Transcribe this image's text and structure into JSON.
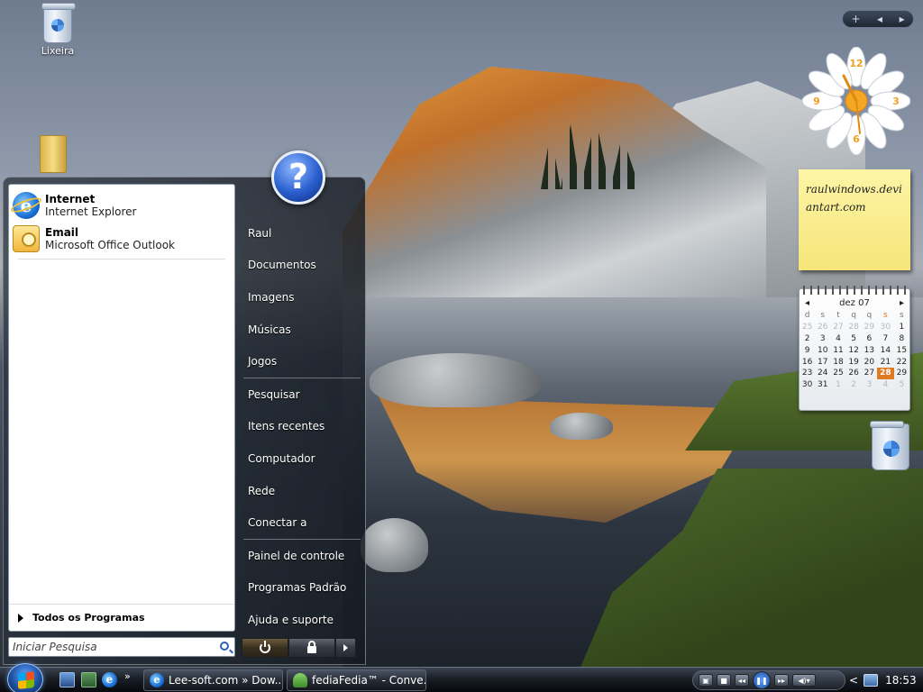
{
  "desktop": {
    "recycle_bin_label": "Lixeira"
  },
  "gadgets": {
    "clock": {
      "numerals": [
        "12",
        "3",
        "6",
        "9"
      ]
    },
    "note": {
      "text": "raulwindows.deviantart.com"
    },
    "calendar": {
      "month_label": "dez 07",
      "day_headers": [
        "d",
        "s",
        "t",
        "q",
        "q",
        "s",
        "s"
      ],
      "weeks": [
        [
          "25",
          "26",
          "27",
          "28",
          "29",
          "30",
          "1"
        ],
        [
          "2",
          "3",
          "4",
          "5",
          "6",
          "7",
          "8"
        ],
        [
          "9",
          "10",
          "11",
          "12",
          "13",
          "14",
          "15"
        ],
        [
          "16",
          "17",
          "18",
          "19",
          "20",
          "21",
          "22"
        ],
        [
          "23",
          "24",
          "25",
          "26",
          "27",
          "28",
          "29"
        ],
        [
          "30",
          "31",
          "1",
          "2",
          "3",
          "4",
          "5"
        ]
      ],
      "today": "28"
    }
  },
  "start_menu": {
    "user_picture_glyph": "?",
    "pinned": [
      {
        "title": "Internet",
        "subtitle": "Internet Explorer"
      },
      {
        "title": "Email",
        "subtitle": "Microsoft Office Outlook"
      }
    ],
    "all_programs_label": "Todos os Programas",
    "search_placeholder": "Iniciar Pesquisa",
    "right_items": [
      "Raul",
      "Documentos",
      "Imagens",
      "Músicas",
      "Jogos",
      "Pesquisar",
      "Itens recentes",
      "Computador",
      "Rede",
      "Conectar a",
      "Painel de controle",
      "Programas Padrão",
      "Ajuda e suporte"
    ]
  },
  "taskbar": {
    "quick_launch_more": "»",
    "tasks": [
      {
        "label": "Lee-soft.com » Dow..."
      },
      {
        "label": "fediaFedia™ - Conve..."
      }
    ],
    "tray_chevron": "<",
    "time": "18:53"
  },
  "sidebar_tools": {
    "add": "+",
    "prev": "◂",
    "next": "▸"
  }
}
